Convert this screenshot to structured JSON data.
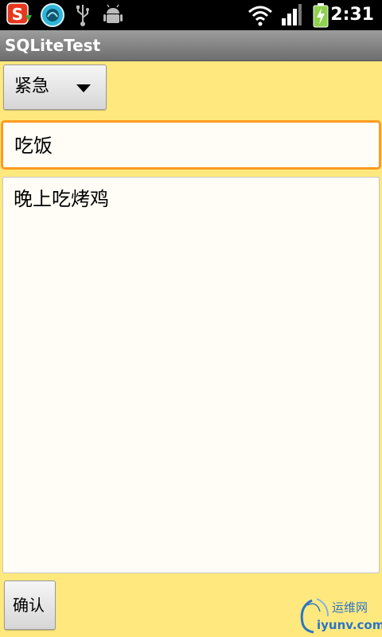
{
  "status_bar": {
    "time": "2:31",
    "icons": [
      "sogou-input-icon",
      "app-notification-icon",
      "usb-icon",
      "android-debug-icon",
      "wifi-icon",
      "signal-icon",
      "battery-charging-icon"
    ]
  },
  "app": {
    "title": "SQLiteTest"
  },
  "form": {
    "priority_value": "紧急",
    "title_value": "吃饭",
    "body_value": "晚上吃烤鸡",
    "confirm_label": "确认"
  },
  "watermark": {
    "cn": "运维网",
    "en": "iyunv.com"
  },
  "colors": {
    "background": "#ffe97f",
    "focus_border": "#ff9a1f",
    "watermark": "#2d74c4"
  }
}
